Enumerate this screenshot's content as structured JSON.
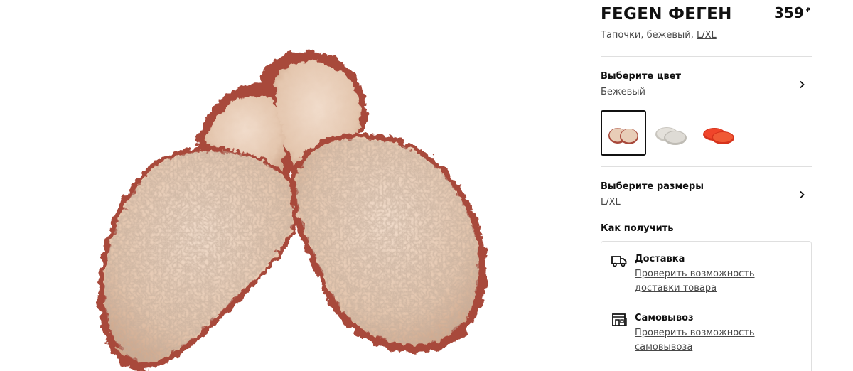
{
  "product": {
    "name": "FEGEN ФЕГЕН",
    "price": "359",
    "currency": "₽",
    "description": "Тапочки, бежевый,",
    "size_link": "L/XL"
  },
  "color_option": {
    "title": "Выберите цвет",
    "value": "Бежевый",
    "swatches": [
      {
        "color": "#e8cdb7",
        "selected": true
      },
      {
        "color": "#d9d6d0",
        "selected": false
      },
      {
        "color": "#f0452a",
        "selected": false
      }
    ]
  },
  "size_option": {
    "title": "Выберите размеры",
    "value": "L/XL"
  },
  "delivery": {
    "section_title": "Как получить",
    "methods": [
      {
        "title": "Доставка",
        "link": "Проверить возможность доставки товара",
        "icon": "truck-icon"
      },
      {
        "title": "Самовывоз",
        "link": "Проверить возможность самовывоза",
        "icon": "store-icon"
      }
    ]
  },
  "colors": {
    "text": "#111111",
    "muted_text": "#484848",
    "divider": "#dfdfdf",
    "fleece": "#e6c9b3",
    "sole_trim": "#a8483a"
  }
}
